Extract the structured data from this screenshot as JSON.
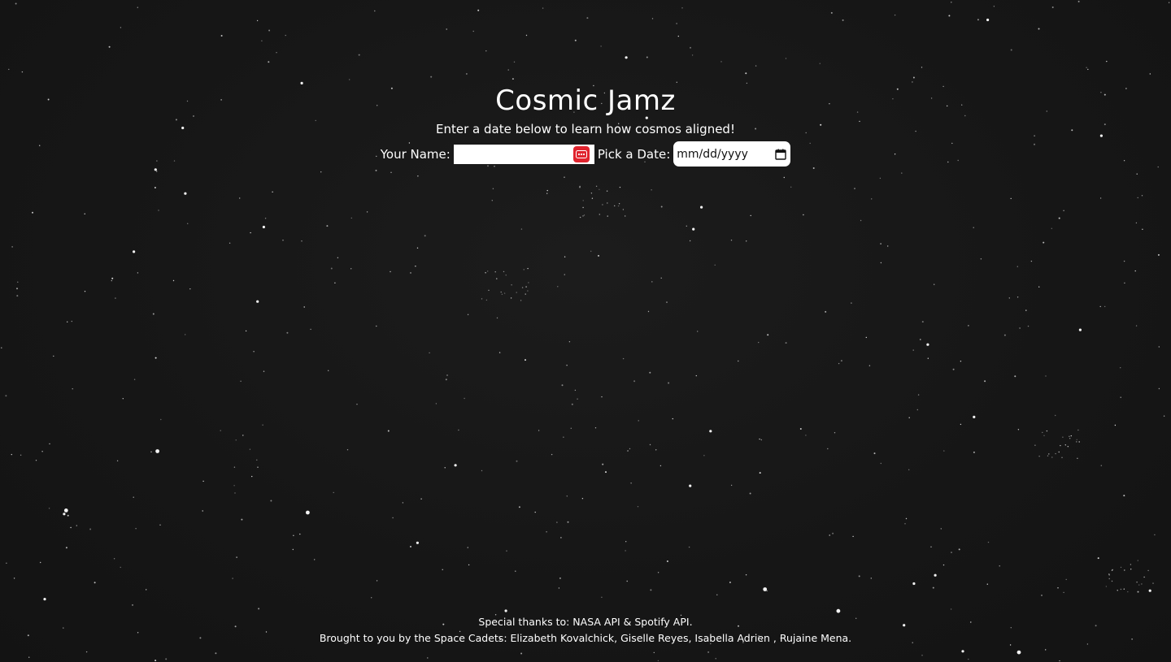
{
  "header": {
    "title": "Cosmic Jamz",
    "subtitle": "Enter a date below to learn how cosmos aligned!"
  },
  "form": {
    "name_label": "Your Name:",
    "name_value": "",
    "name_badge_icon": "password-manager-icon",
    "date_label": "Pick a Date:",
    "date_placeholder": "mm/dd/yyyy",
    "date_icon": "calendar-icon"
  },
  "footer": {
    "thanks": "Special thanks to: NASA API & Spotify API.",
    "credits": "Brought to you by the Space Cadets: Elizabeth Kovalchick, Giselle Reyes, Isabella Adrien , Rujaine Mena."
  },
  "colors": {
    "background": "#171717",
    "text": "#ffffff",
    "badge": "#e0242e"
  }
}
